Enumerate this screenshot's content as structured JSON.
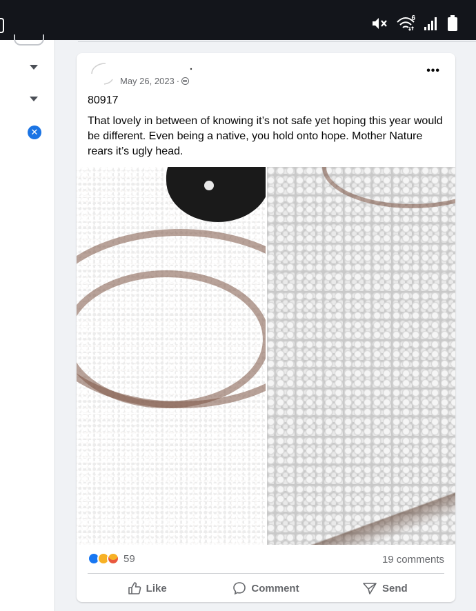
{
  "status": {
    "icons": [
      "mute-icon",
      "wifi-6-icon",
      "signal-icon",
      "battery-icon"
    ],
    "wifi_label": "6"
  },
  "sidebar": {
    "icons": [
      "toggle-switch",
      "caret-down-icon",
      "caret-down-icon",
      "close-circle-icon"
    ],
    "close_glyph": "✕",
    "accent": "#1b74e4"
  },
  "post": {
    "date": "May 26, 2023",
    "separator": "·",
    "more_glyph": "•••",
    "zip": "80917",
    "text": "That lovely in between of knowing it’s not safe yet hoping this year would be different. Even being a native, you hold onto hope. Mother Nature rears it’s ugly head.",
    "photos": [
      "hail-on-wood-photo",
      "hail-closeup-photo"
    ],
    "reaction_count": "59",
    "comments_label": "19 comments",
    "actions": {
      "like": "Like",
      "comment": "Comment",
      "send": "Send"
    }
  }
}
